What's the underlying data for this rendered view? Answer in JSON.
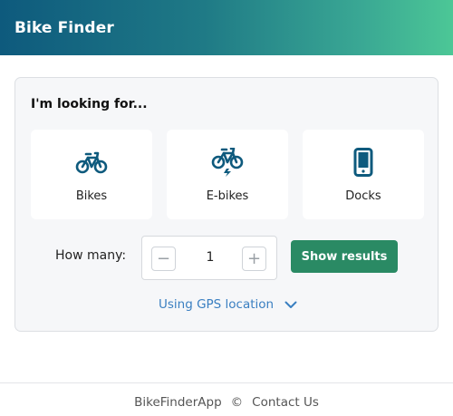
{
  "header": {
    "title": "Bike Finder"
  },
  "search": {
    "heading": "I'm looking for...",
    "options": [
      {
        "label": "Bikes",
        "icon": "bicycle-icon"
      },
      {
        "label": "E-bikes",
        "icon": "ebike-icon"
      },
      {
        "label": "Docks",
        "icon": "phone-dock-icon"
      }
    ],
    "quantity": {
      "label": "How many:",
      "value": "1",
      "minus": "−",
      "plus": "+"
    },
    "submit_label": "Show results",
    "location_label": "Using GPS location"
  },
  "footer": {
    "app_name": "BikeFinderApp",
    "copyright": "©",
    "contact": "Contact Us"
  },
  "colors": {
    "accent_teal": "#0e5a7d",
    "icon_color": "#0e5a7d",
    "button_green": "#2a8a64",
    "link_blue": "#3a7fc1"
  }
}
